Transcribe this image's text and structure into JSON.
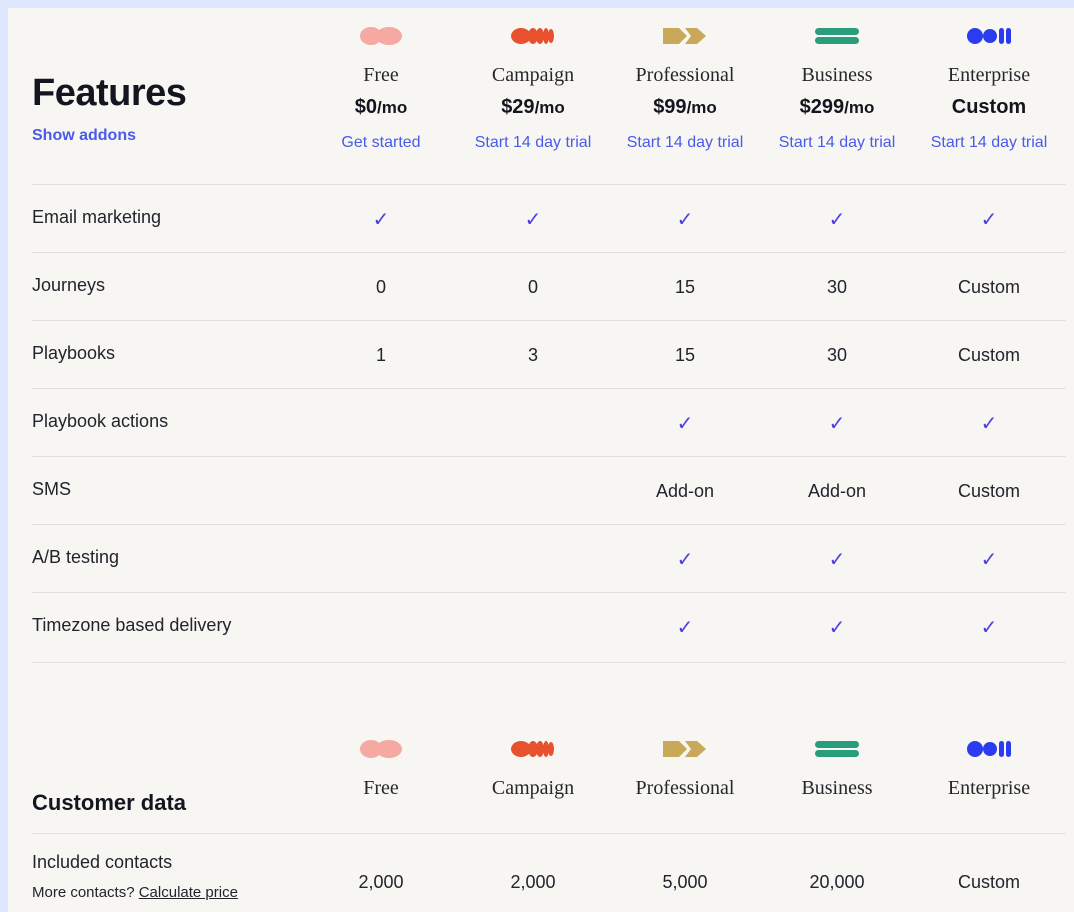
{
  "features_title": "Features",
  "show_addons": "Show addons",
  "plans": [
    {
      "name": "Free",
      "price": "$0",
      "per": "/mo",
      "cta": "Get started",
      "icon": "free-pill-icon",
      "color": "#f6a8a2"
    },
    {
      "name": "Campaign",
      "price": "$29",
      "per": "/mo",
      "cta": "Start 14 day trial",
      "icon": "campaign-dots-icon",
      "color": "#e8512e"
    },
    {
      "name": "Professional",
      "price": "$99",
      "per": "/mo",
      "cta": "Start 14 day trial",
      "icon": "professional-arrows-icon",
      "color": "#c9a85a"
    },
    {
      "name": "Business",
      "price": "$299",
      "per": "/mo",
      "cta": "Start 14 day trial",
      "icon": "business-lines-icon",
      "color": "#2a9d7c"
    },
    {
      "name": "Enterprise",
      "price": "Custom",
      "per": "",
      "cta": "Start 14 day trial",
      "icon": "enterprise-dots-icon",
      "color": "#2a3bf0"
    }
  ],
  "feature_rows": [
    {
      "label": "Email marketing",
      "values": [
        "✓",
        "✓",
        "✓",
        "✓",
        "✓"
      ]
    },
    {
      "label": "Journeys",
      "values": [
        "0",
        "0",
        "15",
        "30",
        "Custom"
      ]
    },
    {
      "label": "Playbooks",
      "values": [
        "1",
        "3",
        "15",
        "30",
        "Custom"
      ]
    },
    {
      "label": "Playbook actions",
      "values": [
        "",
        "",
        "✓",
        "✓",
        "✓"
      ]
    },
    {
      "label": "SMS",
      "values": [
        "",
        "",
        "Add-on",
        "Add-on",
        "Custom"
      ]
    },
    {
      "label": "A/B testing",
      "values": [
        "",
        "",
        "✓",
        "✓",
        "✓"
      ]
    },
    {
      "label": "Timezone based delivery",
      "values": [
        "",
        "",
        "✓",
        "✓",
        "✓"
      ]
    }
  ],
  "customer_data_title": "Customer data",
  "customer_rows": [
    {
      "label": "Included contacts",
      "sub_text": "More contacts? ",
      "sub_link": "Calculate price",
      "values": [
        "2,000",
        "2,000",
        "5,000",
        "20,000",
        "Custom"
      ]
    }
  ],
  "colors": {
    "accent": "#4a5be8",
    "check": "#4b3fe3",
    "page_bg": "#dfe7ff",
    "panel_bg": "#f7f6f3"
  }
}
